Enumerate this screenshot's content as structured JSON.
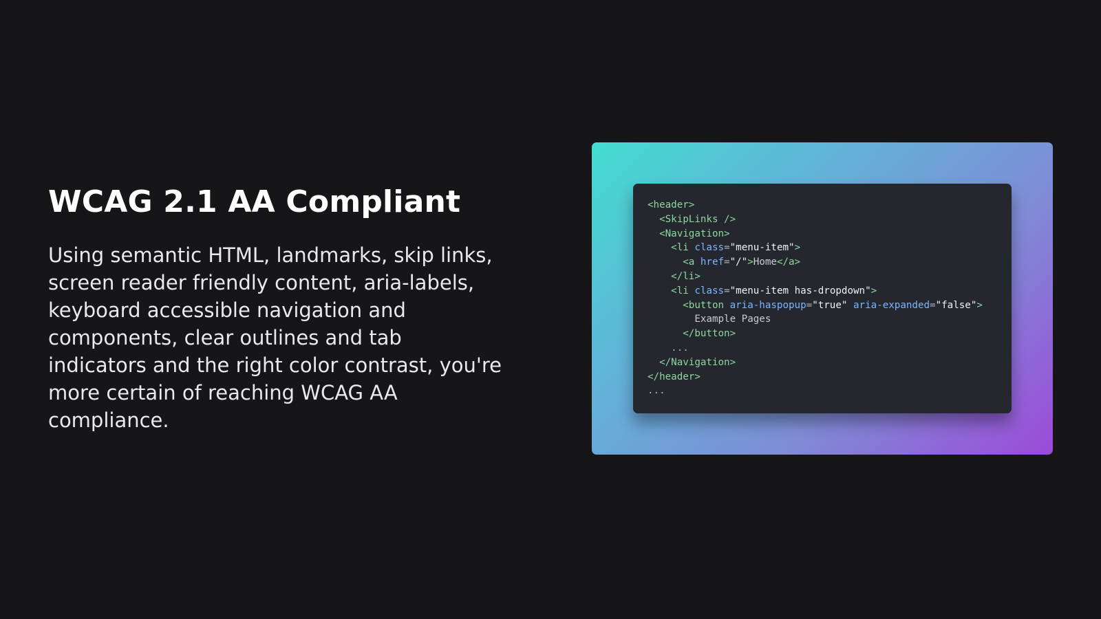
{
  "section": {
    "title": "WCAG 2.1 AA Compliant",
    "description": "Using semantic HTML, landmarks, skip links, screen reader friendly content, aria-labels, keyboard accessible navigation and components, clear outlines and tab indicators and the right color contrast, you're more certain of reaching WCAG AA compliance."
  },
  "code_sample": {
    "colors": {
      "background": "#24272d",
      "tag": "#8fd6a2",
      "attribute": "#7cb6ff",
      "string": "#f0f2f6",
      "gradient_start": "#42ddd0",
      "gradient_end": "#9c4ad8"
    },
    "lines": [
      {
        "indent": 0,
        "tokens": [
          {
            "t": "<header>",
            "c": "tag"
          }
        ]
      },
      {
        "indent": 1,
        "tokens": [
          {
            "t": "<SkipLinks />",
            "c": "tag"
          }
        ]
      },
      {
        "indent": 1,
        "tokens": [
          {
            "t": "<Navigation>",
            "c": "tag"
          }
        ]
      },
      {
        "indent": 2,
        "tokens": [
          {
            "t": "<li ",
            "c": "tag"
          },
          {
            "t": "class",
            "c": "attr"
          },
          {
            "t": "=",
            "c": "punc"
          },
          {
            "t": "\"menu-item\"",
            "c": "str"
          },
          {
            "t": ">",
            "c": "tag"
          }
        ]
      },
      {
        "indent": 3,
        "tokens": [
          {
            "t": "<a ",
            "c": "tag"
          },
          {
            "t": "href",
            "c": "attr"
          },
          {
            "t": "=",
            "c": "punc"
          },
          {
            "t": "\"/\"",
            "c": "str"
          },
          {
            "t": ">",
            "c": "tag"
          },
          {
            "t": "Home",
            "c": "text"
          },
          {
            "t": "</a>",
            "c": "tag"
          }
        ]
      },
      {
        "indent": 2,
        "tokens": [
          {
            "t": "</li>",
            "c": "tag"
          }
        ]
      },
      {
        "indent": 2,
        "tokens": [
          {
            "t": "<li ",
            "c": "tag"
          },
          {
            "t": "class",
            "c": "attr"
          },
          {
            "t": "=",
            "c": "punc"
          },
          {
            "t": "\"menu-item has-dropdown\"",
            "c": "str"
          },
          {
            "t": ">",
            "c": "tag"
          }
        ]
      },
      {
        "indent": 3,
        "tokens": [
          {
            "t": "<button ",
            "c": "tag"
          },
          {
            "t": "aria-haspopup",
            "c": "attr"
          },
          {
            "t": "=",
            "c": "punc"
          },
          {
            "t": "\"true\"",
            "c": "str"
          },
          {
            "t": " ",
            "c": "text"
          },
          {
            "t": "aria-expanded",
            "c": "attr"
          },
          {
            "t": "=",
            "c": "punc"
          },
          {
            "t": "\"false\"",
            "c": "str"
          },
          {
            "t": ">",
            "c": "tag"
          }
        ]
      },
      {
        "indent": 4,
        "tokens": [
          {
            "t": "Example Pages",
            "c": "text"
          }
        ]
      },
      {
        "indent": 3,
        "tokens": [
          {
            "t": "</button>",
            "c": "tag"
          }
        ]
      },
      {
        "indent": 2,
        "tokens": [
          {
            "t": "...",
            "c": "punc"
          }
        ]
      },
      {
        "indent": 1,
        "tokens": [
          {
            "t": "</Navigation>",
            "c": "tag"
          }
        ]
      },
      {
        "indent": 0,
        "tokens": [
          {
            "t": "</header>",
            "c": "tag"
          }
        ]
      },
      {
        "indent": 0,
        "tokens": [
          {
            "t": "...",
            "c": "punc"
          }
        ]
      }
    ]
  }
}
